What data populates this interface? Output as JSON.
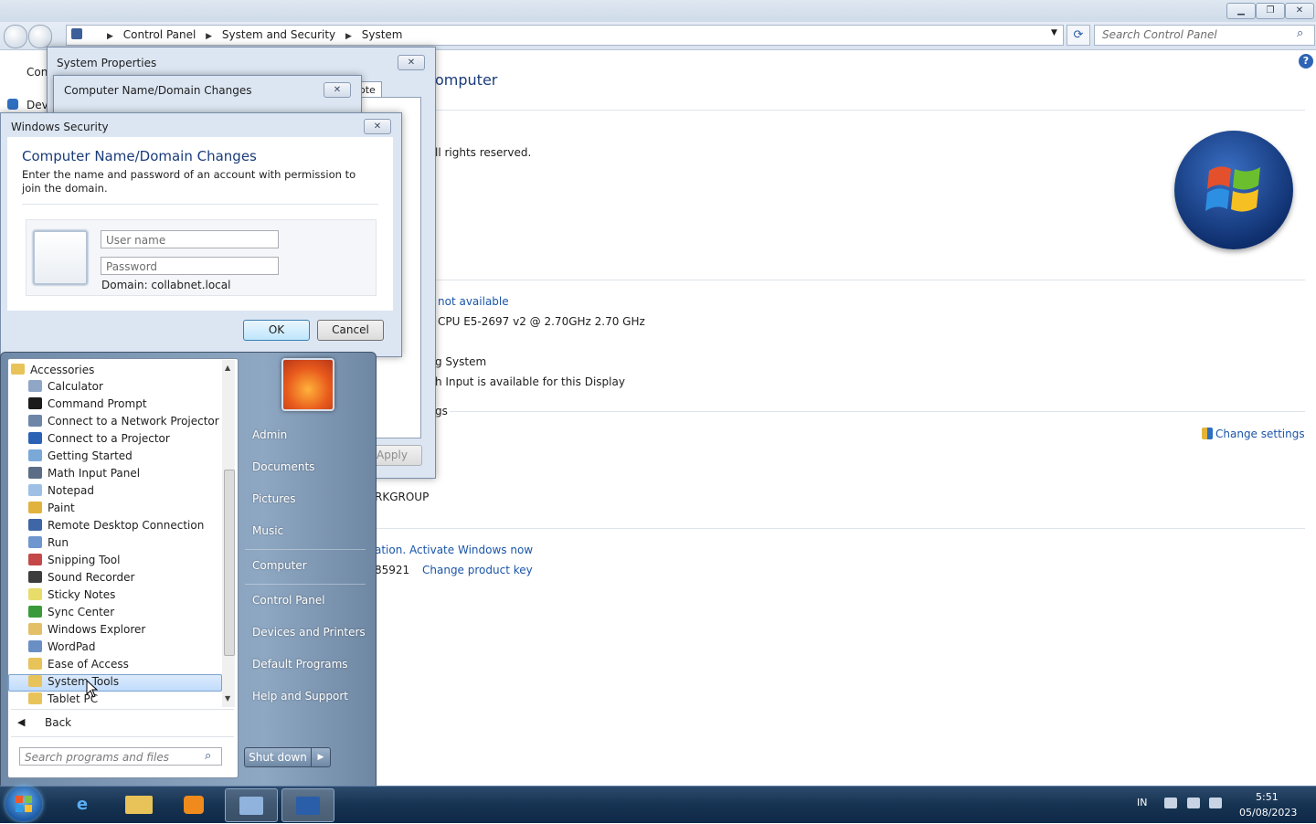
{
  "control_panel": {
    "breadcrumb": [
      "Control Panel",
      "System and Security",
      "System"
    ],
    "search_placeholder": "Search Control Panel",
    "partial_left": {
      "con": "Con",
      "dev": "Dev"
    },
    "heading_partial": "omputer",
    "rights": "ll rights reserved.",
    "rating": "not available",
    "processor": "CPU E5-2697 v2 @ 2.70GHz   2.70 GHz",
    "system_type": "g System",
    "pen_touch": "h Input is available for this Display",
    "settings_group": "gs",
    "change_settings": "Change settings",
    "workgroup": "RKGROUP",
    "activation": "ation. Activate Windows now",
    "product_id": "85921",
    "change_product_key": "Change product key"
  },
  "system_properties": {
    "title": "System Properties",
    "tab_partial": "ote",
    "apply": "Apply"
  },
  "domain_changes": {
    "title": "Computer Name/Domain Changes"
  },
  "windows_security": {
    "title": "Windows Security",
    "heading": "Computer Name/Domain Changes",
    "description": "Enter the name and password of an account with permission to join the domain.",
    "username_placeholder": "User name",
    "password_placeholder": "Password",
    "domain": "Domain: collabnet.local",
    "ok": "OK",
    "cancel": "Cancel"
  },
  "start_menu": {
    "folder": "Accessories",
    "programs": [
      {
        "label": "Calculator",
        "icon": "calculator-icon",
        "color": "#8fa6c6"
      },
      {
        "label": "Command Prompt",
        "icon": "command-prompt-icon",
        "color": "#1b1b1b"
      },
      {
        "label": "Connect to a Network Projector",
        "icon": "network-projector-icon",
        "color": "#6d86a8"
      },
      {
        "label": "Connect to a Projector",
        "icon": "projector-icon",
        "color": "#2b62b3"
      },
      {
        "label": "Getting Started",
        "icon": "getting-started-icon",
        "color": "#7aa9d8"
      },
      {
        "label": "Math Input Panel",
        "icon": "math-input-icon",
        "color": "#5b6d86"
      },
      {
        "label": "Notepad",
        "icon": "notepad-icon",
        "color": "#9fc0e5"
      },
      {
        "label": "Paint",
        "icon": "paint-icon",
        "color": "#e1b23c"
      },
      {
        "label": "Remote Desktop Connection",
        "icon": "remote-desktop-icon",
        "color": "#3f66a6"
      },
      {
        "label": "Run",
        "icon": "run-icon",
        "color": "#6f97cf"
      },
      {
        "label": "Snipping Tool",
        "icon": "snipping-tool-icon",
        "color": "#c44848"
      },
      {
        "label": "Sound Recorder",
        "icon": "microphone-icon",
        "color": "#3d3d3d"
      },
      {
        "label": "Sticky Notes",
        "icon": "sticky-notes-icon",
        "color": "#e8dc6a"
      },
      {
        "label": "Sync Center",
        "icon": "sync-center-icon",
        "color": "#3a9a3a"
      },
      {
        "label": "Windows Explorer",
        "icon": "windows-explorer-icon",
        "color": "#e3c068"
      },
      {
        "label": "WordPad",
        "icon": "wordpad-icon",
        "color": "#6a8fc4"
      },
      {
        "label": "Ease of Access",
        "icon": "folder-icon",
        "color": "#e8c35a"
      },
      {
        "label": "System Tools",
        "icon": "folder-icon",
        "color": "#e8c35a"
      },
      {
        "label": "Tablet PC",
        "icon": "folder-icon",
        "color": "#e8c35a"
      }
    ],
    "back": "Back",
    "search_placeholder": "Search programs and files",
    "right_items": [
      "Admin",
      "Documents",
      "Pictures",
      "Music",
      "Computer",
      "Control Panel",
      "Devices and Printers",
      "Default Programs",
      "Help and Support"
    ],
    "shutdown": "Shut down"
  },
  "taskbar": {
    "language": "IN",
    "time": "5:51",
    "date": "05/08/2023"
  }
}
